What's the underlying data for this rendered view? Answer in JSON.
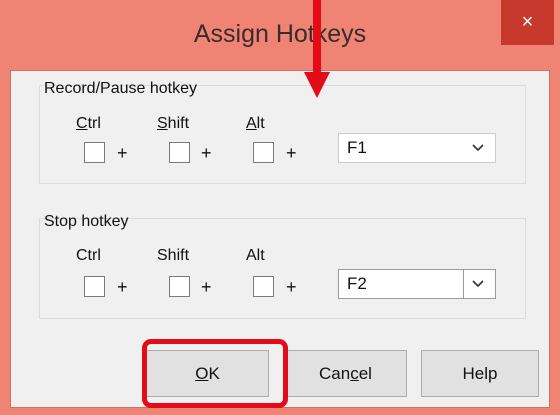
{
  "window": {
    "title": "Assign Hotkeys",
    "close_label": "×"
  },
  "record_group": {
    "label": "Record/Pause hotkey",
    "modifiers": [
      {
        "label": "Ctrl",
        "mnemonic": "C",
        "rest": "trl"
      },
      {
        "label": "Shift",
        "mnemonic": "S",
        "rest": "hift"
      },
      {
        "label": "Alt",
        "mnemonic": "A",
        "rest": "lt"
      }
    ],
    "plus": "+",
    "key_value": "F1"
  },
  "stop_group": {
    "label": "Stop hotkey",
    "modifiers": [
      {
        "label": "Ctrl"
      },
      {
        "label": "Shift"
      },
      {
        "label": "Alt"
      }
    ],
    "plus": "+",
    "key_value": "F2"
  },
  "buttons": {
    "ok": {
      "mnemonic": "O",
      "rest": "K"
    },
    "cancel": {
      "before": "Can",
      "mnemonic": "c",
      "after": "el"
    },
    "help": {
      "label": "Help"
    }
  },
  "colors": {
    "highlight": "#e30b17",
    "titlebar": "#f08474",
    "close_button": "#c7392d"
  }
}
